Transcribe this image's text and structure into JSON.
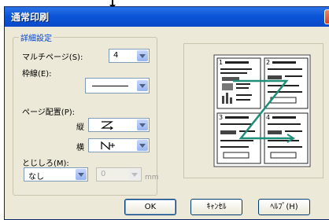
{
  "dialog": {
    "title": "通常印刷",
    "close_label": "X"
  },
  "group": {
    "legend": "詳細設定"
  },
  "multipage": {
    "label": "マルチページ(S):",
    "value": "4"
  },
  "border": {
    "label": "枠線(E):"
  },
  "page_order": {
    "label": "ページ配置(P):",
    "vertical_label": "縦",
    "horizontal_label": "横"
  },
  "binding": {
    "label": "とじしろ(M):",
    "value": "なし",
    "margin_value": "0",
    "unit": "mm"
  },
  "preview": {
    "page_numbers": [
      "1",
      "2",
      "3",
      "4"
    ]
  },
  "buttons": {
    "ok": "OK",
    "cancel": "ｷｬﾝｾﾙ",
    "help": "ﾍﾙﾌﾟ(H)"
  },
  "colors": {
    "titlebar": "#0a55d8",
    "legend_text": "#0046d5",
    "order_line": "#1d8f79"
  }
}
